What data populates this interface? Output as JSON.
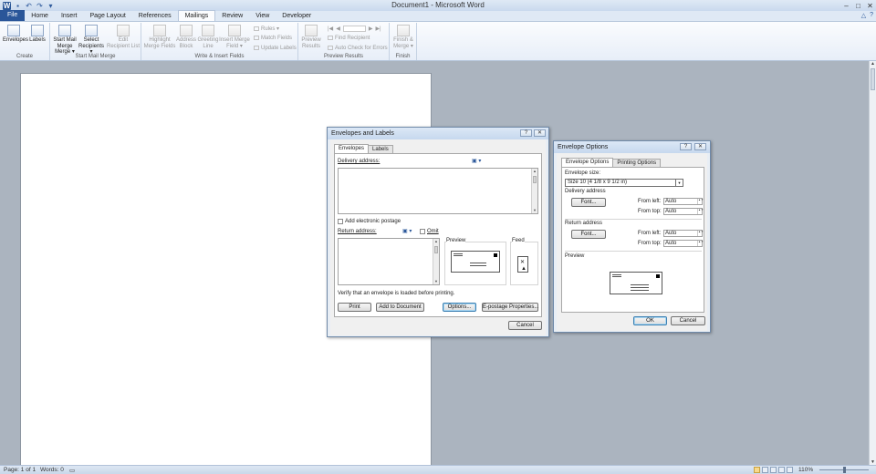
{
  "window": {
    "title": "Document1 - Microsoft Word",
    "minimize": "–",
    "maximize": "□",
    "close": "✕"
  },
  "qat": {
    "save": "💾",
    "undo": "↶",
    "redo": "↷",
    "customize": "▾"
  },
  "tabs": [
    {
      "label": "File"
    },
    {
      "label": "Home"
    },
    {
      "label": "Insert"
    },
    {
      "label": "Page Layout"
    },
    {
      "label": "References"
    },
    {
      "label": "Mailings"
    },
    {
      "label": "Review"
    },
    {
      "label": "View"
    },
    {
      "label": "Developer"
    }
  ],
  "ribbon": {
    "create": {
      "label": "Create",
      "envelopes": "Envelopes",
      "labels": "Labels"
    },
    "start": {
      "label": "Start Mail Merge",
      "start_mail_merge": "Start Mail Merge",
      "start_sub": "Merge ▾",
      "select_recipients": "Select",
      "select_sub": "Recipients ▾",
      "edit_recipient": "Edit",
      "edit_sub": "Recipient List"
    },
    "write": {
      "label": "Write & Insert Fields",
      "highlight": "Highlight",
      "highlight_sub": "Merge Fields",
      "address": "Address",
      "address_sub": "Block",
      "greeting": "Greeting",
      "greeting_sub": "Line",
      "insert_merge": "Insert Merge",
      "insert_sub": "Field ▾",
      "rules": "Rules ▾",
      "match": "Match Fields",
      "update": "Update Labels"
    },
    "preview": {
      "label": "Preview Results",
      "preview_results": "Preview",
      "preview_sub": "Results",
      "find": "Find Recipient",
      "auto_check": "Auto Check for Errors"
    },
    "finish": {
      "label": "Finish",
      "finish_merge": "Finish &",
      "finish_sub": "Merge ▾"
    }
  },
  "status": {
    "page": "Page: 1 of 1",
    "words": "Words: 0",
    "zoom": "110%"
  },
  "env_labels": {
    "title": "Envelopes and Labels",
    "tab_envelopes": "Envelopes",
    "tab_labels": "Labels",
    "delivery_address": "Delivery address:",
    "add_postage": "Add electronic postage",
    "return_address": "Return address:",
    "omit": "Omit",
    "preview": "Preview",
    "feed": "Feed",
    "verify_msg": "Verify that an envelope is loaded before printing.",
    "print": "Print",
    "add_to_document": "Add to Document",
    "options": "Options...",
    "epostage": "E-postage Properties...",
    "cancel": "Cancel"
  },
  "env_options": {
    "title": "Envelope Options",
    "tab_envelope_options": "Envelope Options",
    "tab_printing_options": "Printing Options",
    "envelope_size": "Envelope size:",
    "size_value": "Size 10          (4 1/8 x 9 1/2 in)",
    "delivery_address": "Delivery address",
    "font": "Font...",
    "from_left": "From left:",
    "from_top": "From top:",
    "auto": "Auto",
    "return_address": "Return address",
    "preview": "Preview",
    "ok": "OK",
    "cancel": "Cancel"
  }
}
